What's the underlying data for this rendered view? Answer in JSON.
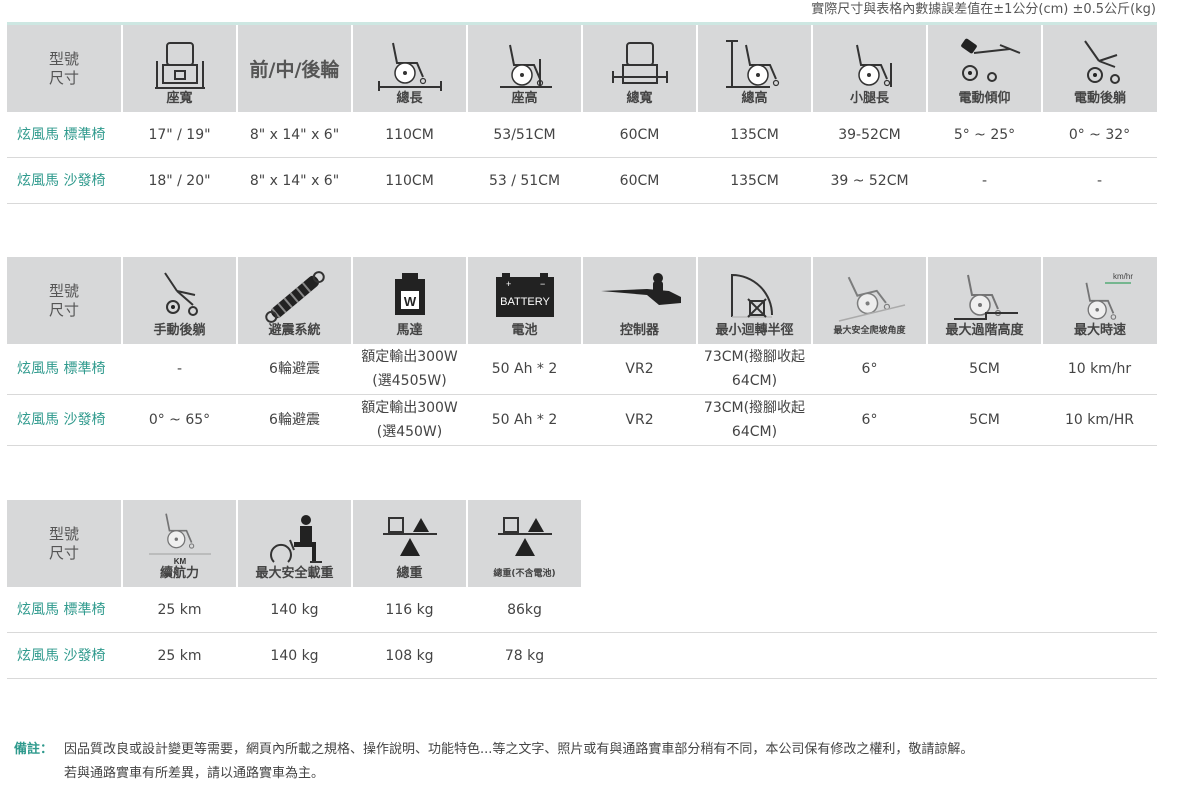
{
  "top_note": "實際尺寸與表格內數據誤差值在±1公分(cm) ±0.5公斤(kg)",
  "row_label": [
    "型號",
    "尺寸"
  ],
  "tables": [
    {
      "headers": [
        {
          "type": "text",
          "text": "前/中/後輪"
        },
        {
          "type": "icon",
          "icon": "seat-width-icon",
          "label": "座寬"
        },
        {
          "type": "icon",
          "icon": "total-length-icon",
          "label": "總長"
        },
        {
          "type": "icon",
          "icon": "seat-height-icon",
          "label": "座高"
        },
        {
          "type": "icon",
          "icon": "total-width-icon",
          "label": "總寬"
        },
        {
          "type": "icon",
          "icon": "total-height-icon",
          "label": "總高"
        },
        {
          "type": "icon",
          "icon": "leg-length-icon",
          "label": "小腿長"
        },
        {
          "type": "icon",
          "icon": "power-tilt-icon",
          "label": "電動傾仰"
        },
        {
          "type": "icon",
          "icon": "power-recline-icon",
          "label": "電動後躺"
        }
      ],
      "rows": [
        {
          "model": "炫風馬 標準椅",
          "values": [
            "17\" / 19\"",
            "8\" x 14\" x 6\"",
            "110CM",
            "53/51CM",
            "60CM",
            "135CM",
            "39-52CM",
            "5° ~ 25°",
            "0° ~ 32°"
          ]
        },
        {
          "model": "炫風馬 沙發椅",
          "values": [
            "18\" / 20\"",
            "8\" x 14\" x 6\"",
            "110CM",
            "53 / 51CM",
            "60CM",
            "135CM",
            "39 ~ 52CM",
            "-",
            "-"
          ]
        }
      ]
    },
    {
      "headers": [
        {
          "type": "icon",
          "icon": "manual-recline-icon",
          "label": "手動後躺"
        },
        {
          "type": "icon",
          "icon": "suspension-icon",
          "label": "避震系統"
        },
        {
          "type": "icon",
          "icon": "motor-icon",
          "label": "馬達",
          "icon_text": "W"
        },
        {
          "type": "icon",
          "icon": "battery-icon",
          "label": "電池",
          "icon_text": "BATTERY"
        },
        {
          "type": "icon",
          "icon": "controller-icon",
          "label": "控制器"
        },
        {
          "type": "icon",
          "icon": "turning-radius-icon",
          "label": "最小迴轉半徑"
        },
        {
          "type": "icon",
          "icon": "slope-icon",
          "label": "最大安全爬坡角度"
        },
        {
          "type": "icon",
          "icon": "step-height-icon",
          "label": "最大過階高度"
        },
        {
          "type": "icon",
          "icon": "max-speed-icon",
          "label": "最大時速",
          "icon_text": "km/hr"
        }
      ],
      "rows": [
        {
          "model": "炫風馬 標準椅",
          "values": [
            "-",
            "6輪避震",
            "額定輸出300W (選4505W)",
            "50 Ah * 2",
            "VR2",
            "73CM(撥腳收起 64CM)",
            "6°",
            "5CM",
            "10 km/hr"
          ]
        },
        {
          "model": "炫風馬 沙發椅",
          "values": [
            "0° ~ 65°",
            "6輪避震",
            "額定輸出300W (選450W)",
            "50 Ah * 2",
            "VR2",
            "73CM(撥腳收起 64CM)",
            "6°",
            "5CM",
            "10 km/HR"
          ]
        }
      ]
    },
    {
      "headers": [
        {
          "type": "icon",
          "icon": "range-icon",
          "label": "續航力",
          "icon_text": "KM"
        },
        {
          "type": "icon",
          "icon": "max-load-icon",
          "label": "最大安全載重"
        },
        {
          "type": "icon",
          "icon": "total-weight-icon",
          "label": "總重"
        },
        {
          "type": "icon",
          "icon": "weight-no-battery-icon",
          "label": "總重(不含電池)"
        }
      ],
      "rows": [
        {
          "model": "炫風馬 標準椅",
          "values": [
            "25 km",
            "140 kg",
            "116 kg",
            "86kg"
          ]
        },
        {
          "model": "炫風馬 沙發椅",
          "values": [
            "25 km",
            "140 kg",
            "108 kg",
            "78 kg"
          ]
        }
      ]
    }
  ],
  "remarks": {
    "label": "備註：",
    "line1": "因品質改良或設計變更等需要，網頁內所載之規格、操作說明、功能特色...等之文字、照片或有與通路實車部分稍有不同，本公司保有修改之權利，敬請諒解。",
    "line2": "若與通路實車有所差異，請以通路實車為主。"
  }
}
